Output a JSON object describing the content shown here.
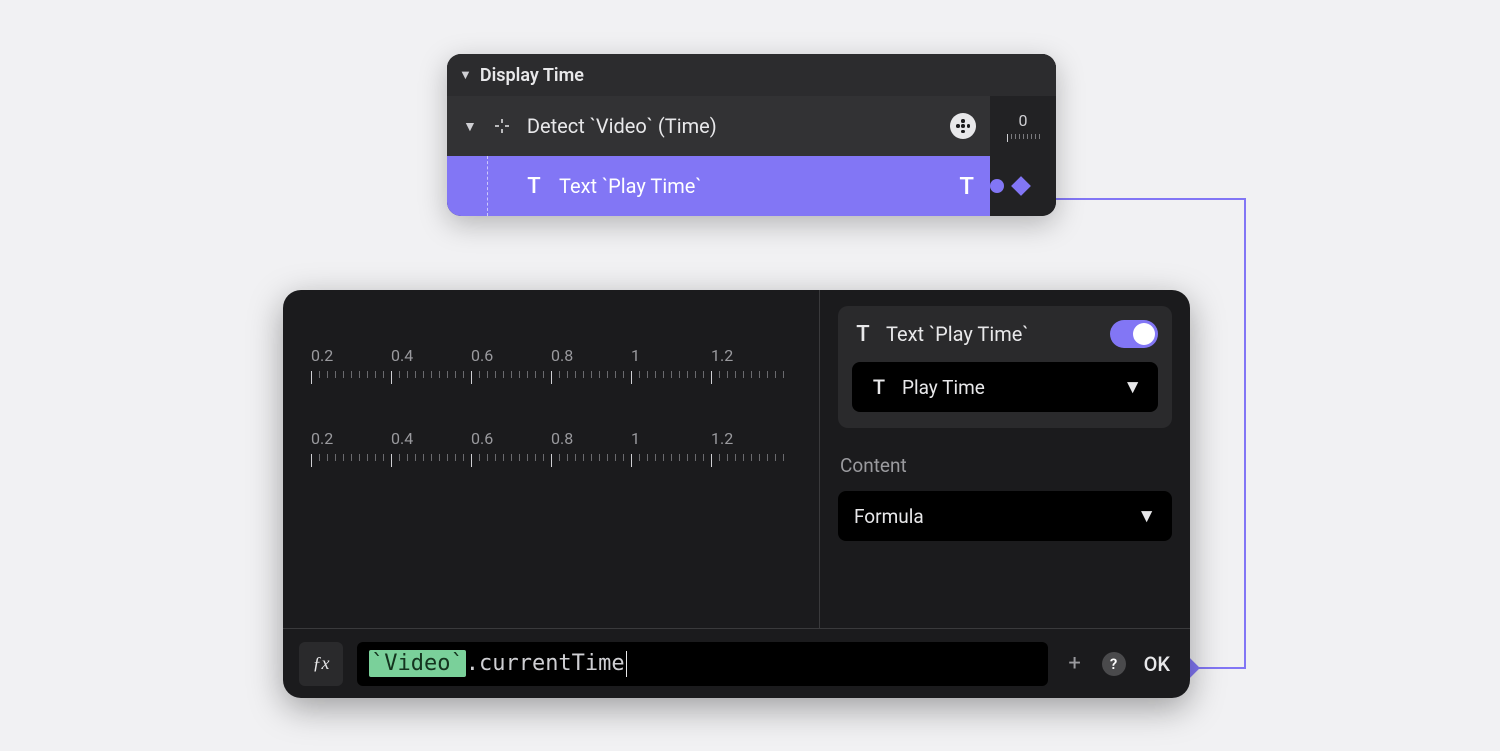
{
  "top_panel": {
    "title": "Display Time",
    "detect_row": {
      "label": "Detect `Video` (Time)",
      "icon": "detect-icon",
      "trailing_icon": "film-reel-icon"
    },
    "text_row": {
      "label": "Text `Play Time`",
      "icon": "text-icon",
      "trailing_icon": "text-icon"
    },
    "timeline_label": "0"
  },
  "bottom_panel": {
    "ruler1": [
      "0.2",
      "0.4",
      "0.6",
      "0.8",
      "1",
      "1.2"
    ],
    "ruler2": [
      "0.2",
      "0.4",
      "0.6",
      "0.8",
      "1",
      "1.2"
    ],
    "layer": {
      "title": "Text `Play Time`",
      "toggle_on": true,
      "select_value": "Play Time",
      "select_icon": "text-icon"
    },
    "content_section": {
      "label": "Content",
      "select_value": "Formula"
    },
    "formula": {
      "fx_label": "ƒx",
      "token": "`Video`",
      "suffix": ".currentTime",
      "add_label": "+",
      "help_label": "?",
      "ok_label": "OK"
    }
  },
  "colors": {
    "accent": "#8276f5",
    "token_bg": "#7ad09a"
  }
}
